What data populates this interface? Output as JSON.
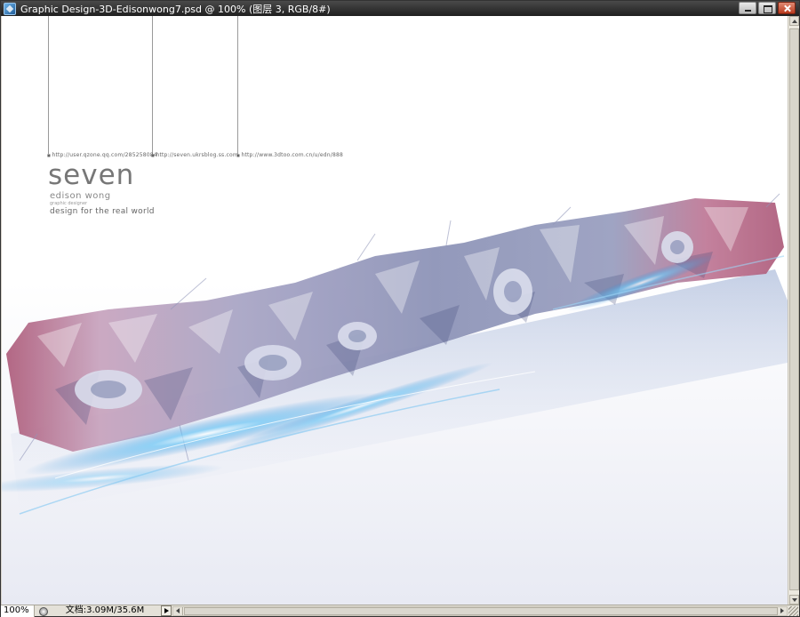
{
  "window": {
    "title": "Graphic Design-3D-Edisonwong7.psd @ 100% (图层 3, RGB/8#)",
    "icon": "photoshop-document-icon",
    "buttons": [
      "minimize-icon",
      "maximize-icon",
      "close-icon"
    ]
  },
  "canvas": {
    "background": "#ffffff",
    "urls": [
      "http://user.qzone.qq.com/285258084",
      "http://seven.ukrsblog.ss.com",
      "http://www.3dtoo.com.cn/u/edn/888"
    ],
    "logo": {
      "wordmark": "seven",
      "name": "edison wong",
      "role": "graphic designer",
      "tagline": "design for the real world"
    },
    "artwork_colors": {
      "pink": "#b0607e",
      "lavender": "#a9a6c6",
      "blue_glow": "#3aa7e6",
      "steel": "#6f7aa6"
    }
  },
  "statusbar": {
    "zoom": "100%",
    "doc_info": "文档:3.09M/35.6M"
  }
}
